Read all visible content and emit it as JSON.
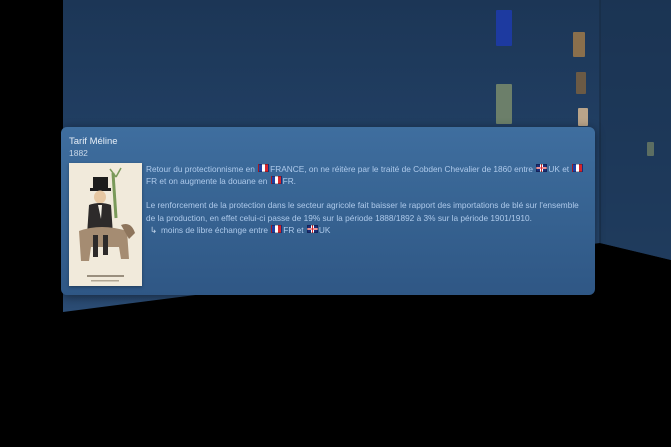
{
  "event": {
    "title": "Tarif Méline",
    "year": "1882"
  },
  "paragraph1": {
    "t1": "Retour du protectionnisme en ",
    "t2": "FRANCE, on ne réitère par le traité de Cobden Chevalier de 1860 entre ",
    "t3": "UK et ",
    "t4": "FR et on augmente la douane en ",
    "t5": "FR."
  },
  "paragraph2": {
    "text": "Le renforcement de la protection dans le secteur agricole fait baisser le rapport des importations de blé sur l'ensemble de la production, en effet celui-ci passe de 19% sur la période 1888/1892 à 3% sur la période 1901/1910."
  },
  "paragraph3": {
    "arrow": "↳",
    "t1": "moins de libre échange entre ",
    "t2": "FR et ",
    "t3": "UK"
  },
  "icons": {
    "france": "flag-france-icon",
    "uk": "flag-uk-icon"
  },
  "colors": {
    "card_background": "#386594",
    "body_text": "#aecaeb",
    "wall": "#1f3a5c"
  }
}
